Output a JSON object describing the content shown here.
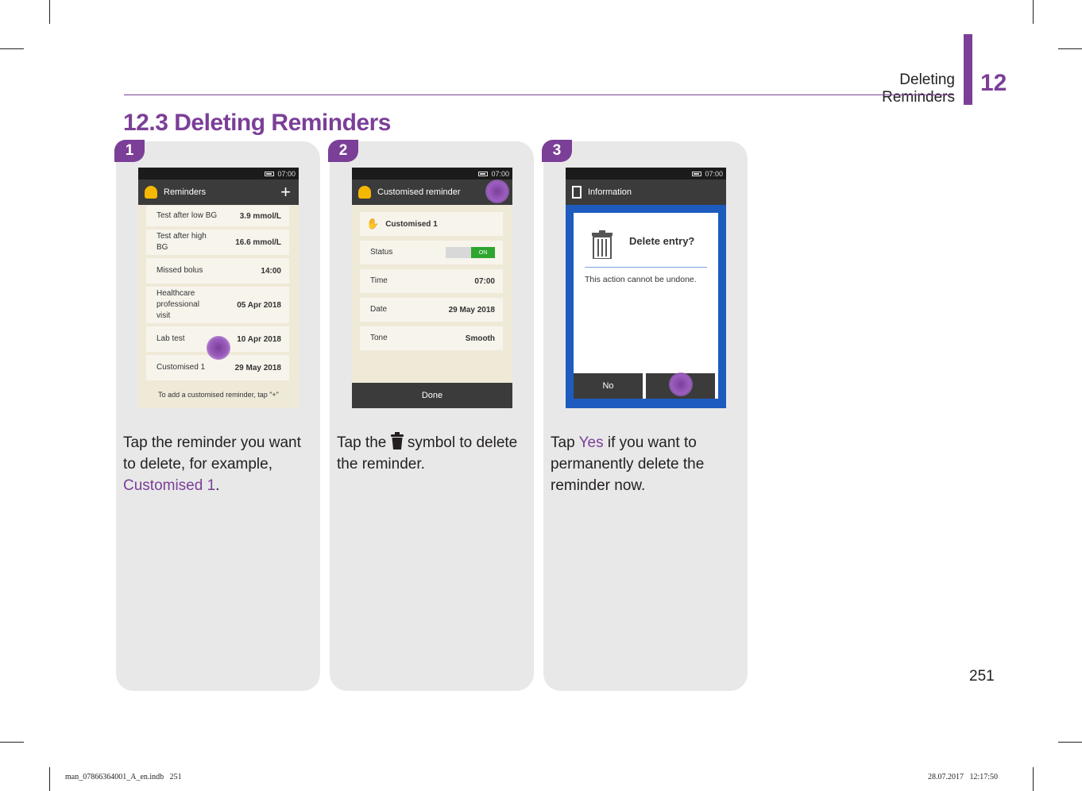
{
  "header": {
    "running_title": "Deleting Reminders",
    "chapter_number": "12"
  },
  "section": {
    "title": "12.3 Deleting Reminders"
  },
  "steps": [
    {
      "number": "1",
      "screen": {
        "time": "07:00",
        "title": "Reminders",
        "add_symbol": "+",
        "rows": [
          {
            "label": "Test after low BG",
            "value": "3.9 mmol/L"
          },
          {
            "label": "Test after high BG",
            "value": "16.6 mmol/L"
          },
          {
            "label": "Missed bolus",
            "value": "14:00"
          },
          {
            "label": "Healthcare professional visit",
            "value": "05 Apr 2018"
          },
          {
            "label": "Lab test",
            "value": "10 Apr 2018"
          },
          {
            "label": "Customised 1",
            "value": "29 May 2018"
          }
        ],
        "footer": "To add a customised reminder, tap \"+\""
      },
      "text_before": "Tap the reminder you want to delete, for example, ",
      "text_highlight": "Customised 1",
      "text_after": "."
    },
    {
      "number": "2",
      "screen": {
        "time": "07:00",
        "title": "Customised reminder",
        "name_row": "Customised 1",
        "rows": [
          {
            "label": "Status",
            "value": "ON"
          },
          {
            "label": "Time",
            "value": "07:00"
          },
          {
            "label": "Date",
            "value": "29 May 2018"
          },
          {
            "label": "Tone",
            "value": "Smooth"
          }
        ],
        "done_label": "Done"
      },
      "text_before": "Tap the ",
      "text_after": " symbol to delete the reminder."
    },
    {
      "number": "3",
      "screen": {
        "time": "07:00",
        "title": "Information",
        "dialog_title": "Delete entry?",
        "dialog_message": "This action cannot be undone.",
        "no_label": "No"
      },
      "text_before": "Tap ",
      "text_highlight": "Yes",
      "text_after": " if you want to permanently delete the reminder now."
    }
  ],
  "page_number": "251",
  "slug": {
    "left": "man_07866364001_A_en.indb   251",
    "right": "28.07.2017   12:17:50"
  },
  "colors": {
    "accent": "#7b3f98",
    "panel": "#e8e8e8",
    "dialog_blue": "#1e5bbf"
  }
}
